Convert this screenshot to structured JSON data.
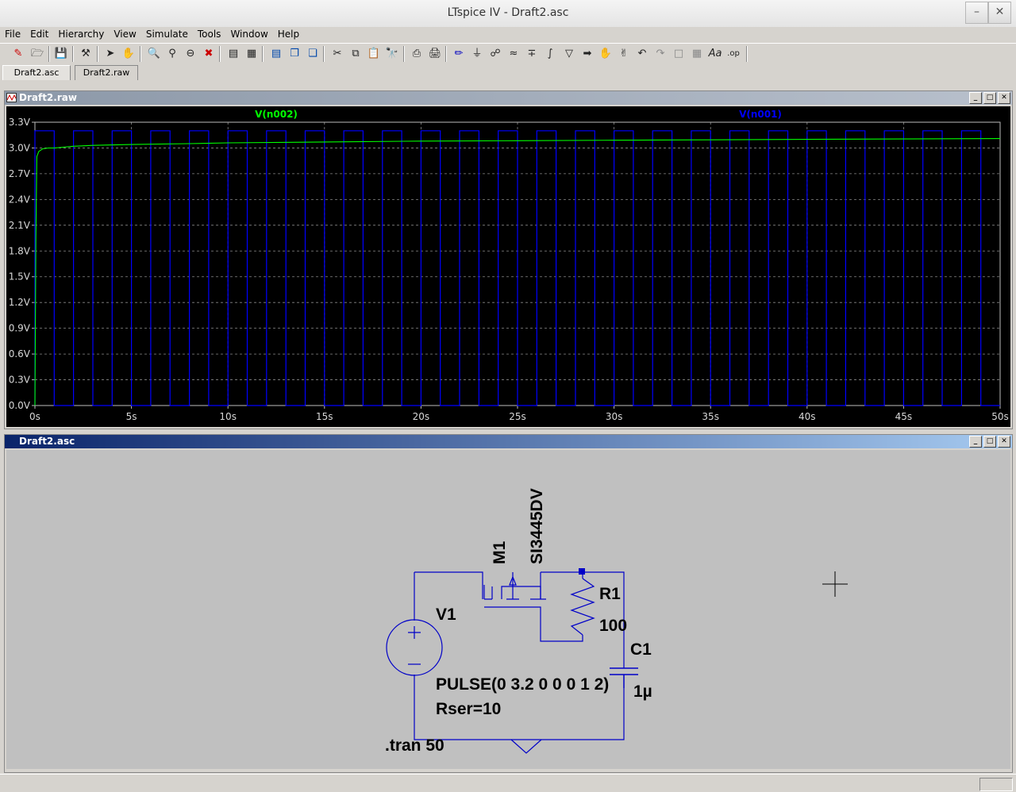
{
  "window": {
    "title": "LTspice IV - Draft2.asc"
  },
  "menu": [
    "File",
    "Edit",
    "Hierarchy",
    "View",
    "Simulate",
    "Tools",
    "Window",
    "Help"
  ],
  "tabs": [
    {
      "label": "Draft2.asc",
      "active": true
    },
    {
      "label": "Draft2.raw",
      "active": false
    }
  ],
  "waveform_window": {
    "title": "Draft2.raw",
    "trace_labels": [
      {
        "name": "V(n002)",
        "color": "#00ff00"
      },
      {
        "name": "V(n001)",
        "color": "#0000ff"
      }
    ]
  },
  "chart_data": {
    "type": "line",
    "xlabel": "",
    "ylabel": "",
    "xlim": [
      0,
      50
    ],
    "ylim": [
      0,
      3.3
    ],
    "x_ticks": [
      "0s",
      "5s",
      "10s",
      "15s",
      "20s",
      "25s",
      "30s",
      "35s",
      "40s",
      "45s",
      "50s"
    ],
    "y_ticks": [
      "0.0V",
      "0.3V",
      "0.6V",
      "0.9V",
      "1.2V",
      "1.5V",
      "1.8V",
      "2.1V",
      "2.4V",
      "2.7V",
      "3.0V",
      "3.3V"
    ],
    "background": "#000000",
    "grid": true,
    "series": [
      {
        "name": "V(n002)",
        "color": "#00ff00",
        "x": [
          0,
          0.05,
          0.1,
          0.2,
          0.4,
          0.7,
          1,
          2,
          3,
          5,
          8,
          10,
          15,
          20,
          25,
          30,
          35,
          40,
          45,
          50
        ],
        "y": [
          0,
          1.95,
          2.9,
          2.96,
          2.99,
          3.0,
          3.0,
          3.02,
          3.03,
          3.04,
          3.05,
          3.06,
          3.07,
          3.08,
          3.085,
          3.09,
          3.095,
          3.1,
          3.105,
          3.11
        ]
      },
      {
        "name": "V(n001)",
        "color": "#0000ff",
        "pulse": {
          "low": 0,
          "high": 3.2,
          "period": 2,
          "on_time": 1,
          "start": 0,
          "end": 50
        }
      }
    ]
  },
  "schematic_window": {
    "title": "Draft2.asc",
    "labels": {
      "v1_name": "V1",
      "v1_value_line1": "PULSE(0 3.2 0 0 0 1 2)",
      "v1_value_line2": "Rser=10",
      "m1_name": "M1",
      "m1_model": "SI3445DV",
      "r1_name": "R1",
      "r1_value": "100",
      "c1_name": "C1",
      "c1_value": "1µ",
      "directive": ".tran 50"
    }
  },
  "colors": {
    "wire": "#0000c8",
    "schematic_bg": "#c0c0c0",
    "text": "#000000",
    "trace_green": "#00ff00",
    "trace_blue": "#0000ff"
  }
}
